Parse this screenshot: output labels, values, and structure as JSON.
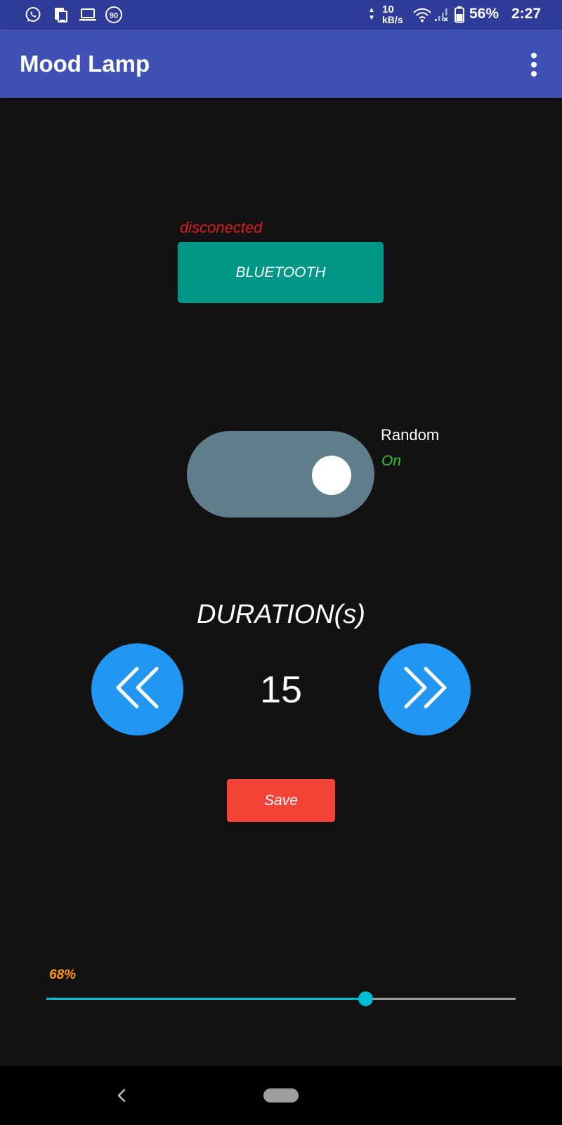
{
  "status_bar": {
    "icons": [
      "whatsapp-icon",
      "device-icon",
      "laptop-icon",
      "speed-90-icon",
      "wifi-icon",
      "no-signal-icon",
      "battery-icon"
    ],
    "speed_badge": "90",
    "net_speed_value": "10",
    "net_speed_unit": "kB/s",
    "battery_percent": "56%",
    "time": "2:27",
    "background": "#2e3b98"
  },
  "app_bar": {
    "title": "Mood Lamp",
    "menu_icon": "more-vert-icon",
    "background": "#3f51b5"
  },
  "bluetooth": {
    "status": "disconected",
    "status_color": "#e0191d",
    "button_label": "BLUETOOTH",
    "button_color": "#009688"
  },
  "random": {
    "label": "Random",
    "state": "On",
    "state_color": "#33c333",
    "enabled": true
  },
  "duration": {
    "title": "DURATION(s)",
    "value": "15",
    "decrease_icon": "double-chevron-left-icon",
    "increase_icon": "double-chevron-right-icon",
    "button_color": "#2196f3"
  },
  "save": {
    "label": "Save",
    "color": "#f44336"
  },
  "brightness": {
    "label": "68%",
    "value": 0.68,
    "label_color": "#ff9800",
    "accent": "#00bcd4"
  },
  "nav_bar": {
    "back_icon": "back-chevron-icon",
    "home_icon": "home-pill-icon"
  }
}
